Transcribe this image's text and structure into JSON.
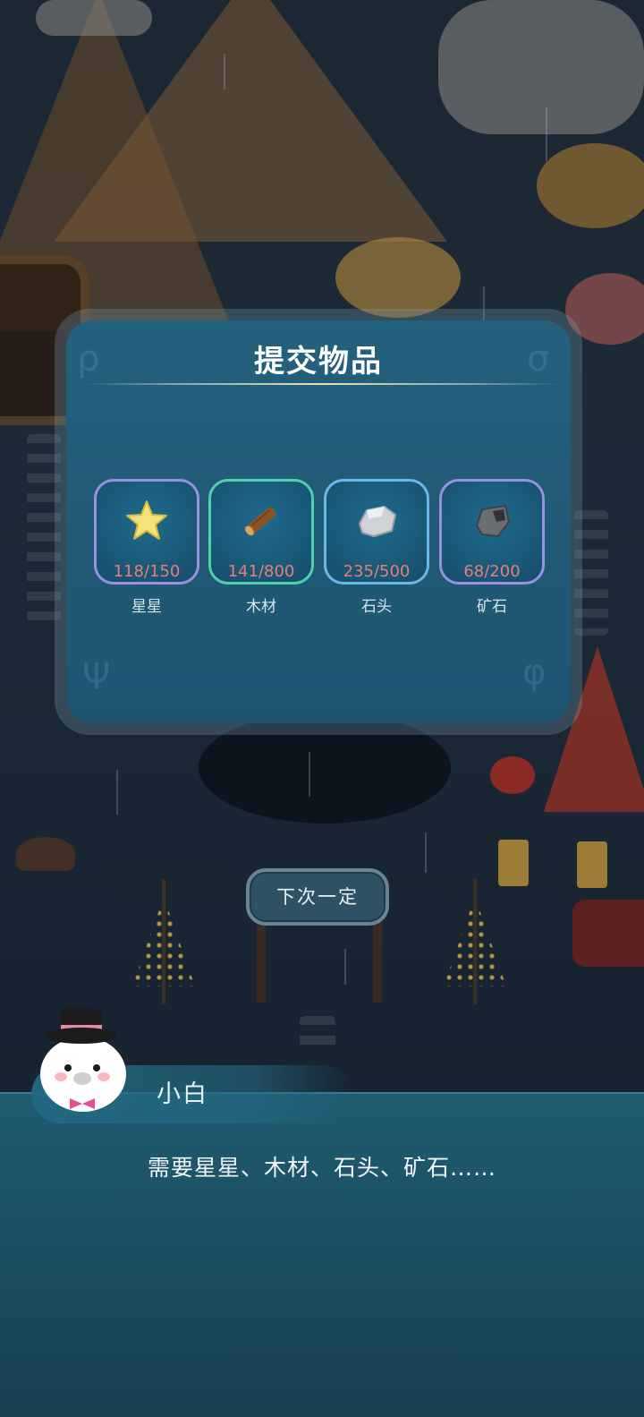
{
  "panel": {
    "title": "提交物品"
  },
  "items": [
    {
      "name": "星星",
      "count": "118/150",
      "icon": "star-icon",
      "border": "#9a8fe0"
    },
    {
      "name": "木材",
      "count": "141/800",
      "icon": "wood-log-icon",
      "border": "#4fd0b0"
    },
    {
      "name": "石头",
      "count": "235/500",
      "icon": "stone-icon",
      "border": "#6ab8e8"
    },
    {
      "name": "矿石",
      "count": "68/200",
      "icon": "ore-icon",
      "border": "#9a8fe0"
    }
  ],
  "buttons": {
    "next_time": "下次一定"
  },
  "dialog": {
    "speaker": "小白",
    "text": "需要星星、木材、石头、矿石……"
  },
  "colors": {
    "count_text": "#e57f7b",
    "panel_bg": "#23607c",
    "dialog_bg": "#1d5469"
  }
}
